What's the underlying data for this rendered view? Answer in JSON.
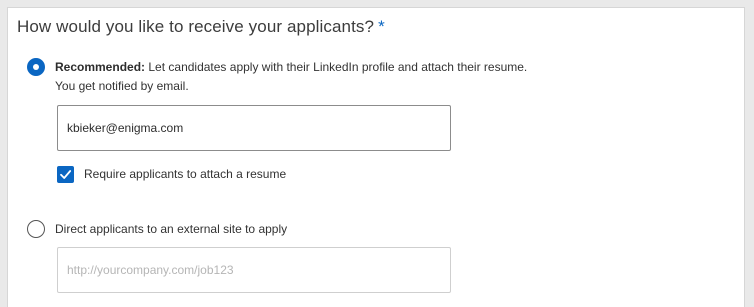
{
  "question": {
    "text": "How would you like to receive your applicants?",
    "required_marker": "*"
  },
  "options": {
    "recommended": {
      "bold_label": "Recommended:",
      "text": "Let candidates apply with their LinkedIn profile and attach their resume.",
      "subtext": "You get notified by email.",
      "selected": true,
      "email_value": "kbieker@enigma.com",
      "require_resume": {
        "label": "Require applicants to attach a resume",
        "checked": true
      }
    },
    "external": {
      "text": "Direct applicants to an external site to apply",
      "selected": false,
      "url_placeholder": "http://yourcompany.com/job123"
    }
  },
  "colors": {
    "accent": "#0a66c2"
  }
}
